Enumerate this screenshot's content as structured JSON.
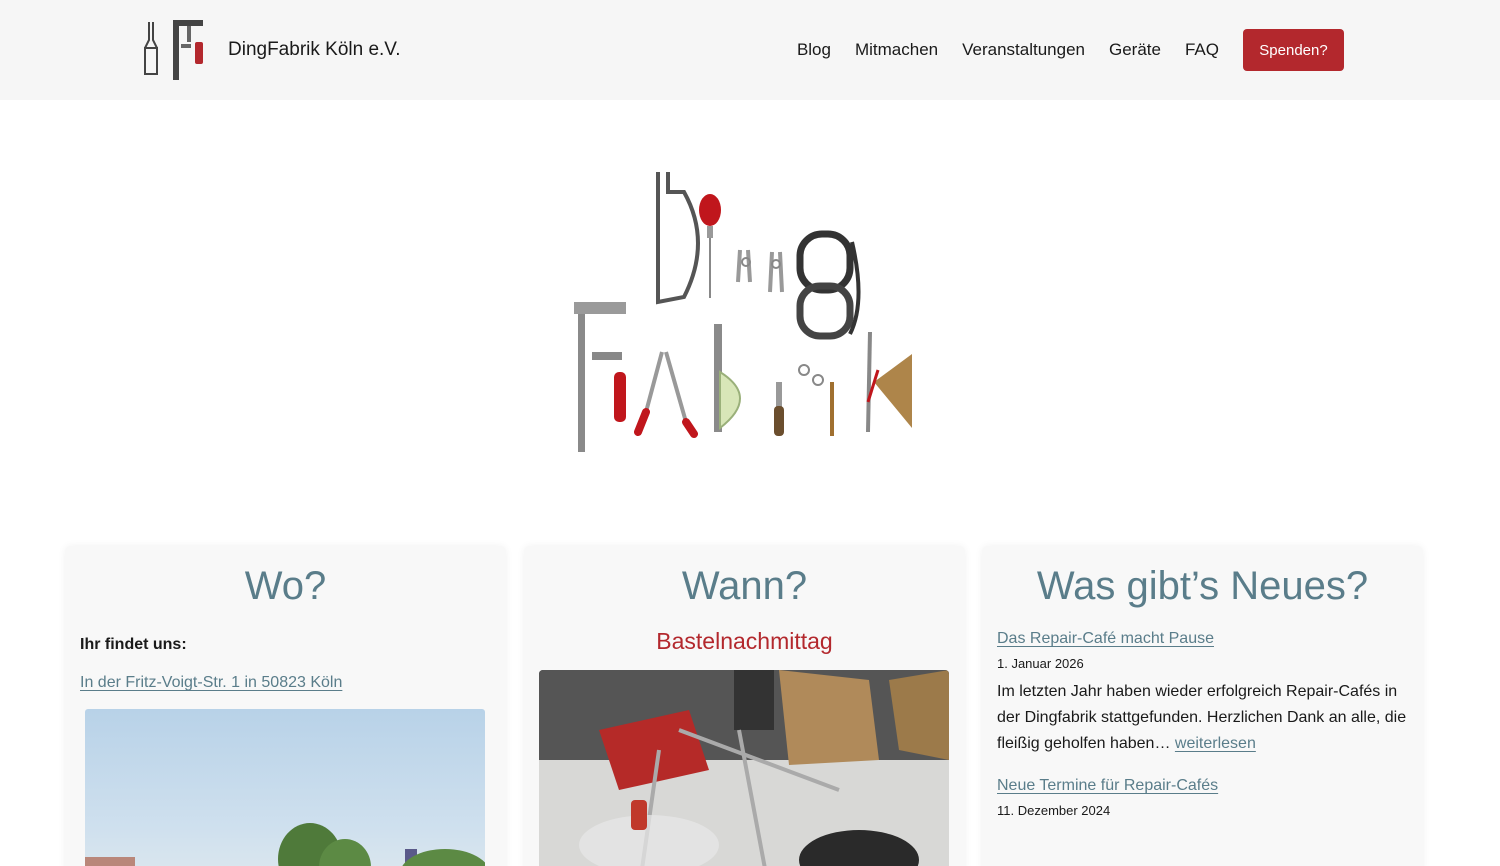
{
  "brand": {
    "name": "DingFabrik Köln e.V."
  },
  "nav": {
    "items": [
      "Blog",
      "Mitmachen",
      "Veranstaltungen",
      "Geräte",
      "FAQ"
    ],
    "donate_label": "Spenden?"
  },
  "colors": {
    "accent": "#b3282d",
    "heading": "#5a7d8a",
    "header_bg": "#f6f6f6"
  },
  "cards": {
    "wo": {
      "title": "Wo?",
      "label": "Ihr findet uns:",
      "address_link": "In der Fritz-Voigt-Str. 1 in 50823 Köln"
    },
    "wann": {
      "title": "Wann?",
      "subtitle": "Bastelnachmittag"
    },
    "neu": {
      "title": "Was gibt’s Neues?",
      "items": [
        {
          "title": "Das Repair-Café macht Pause",
          "date": "1. Januar 2026",
          "text": "Im letzten Jahr haben wieder erfolgreich Repair-Cafés in der Dingfabrik stattgefunden. Herzlichen Dank an alle, die fleißig geholfen haben…",
          "more": "weiterlesen"
        },
        {
          "title": "Neue Termine für Repair-Cafés",
          "date": "11. Dezember 2024",
          "text": "",
          "more": ""
        }
      ]
    }
  }
}
